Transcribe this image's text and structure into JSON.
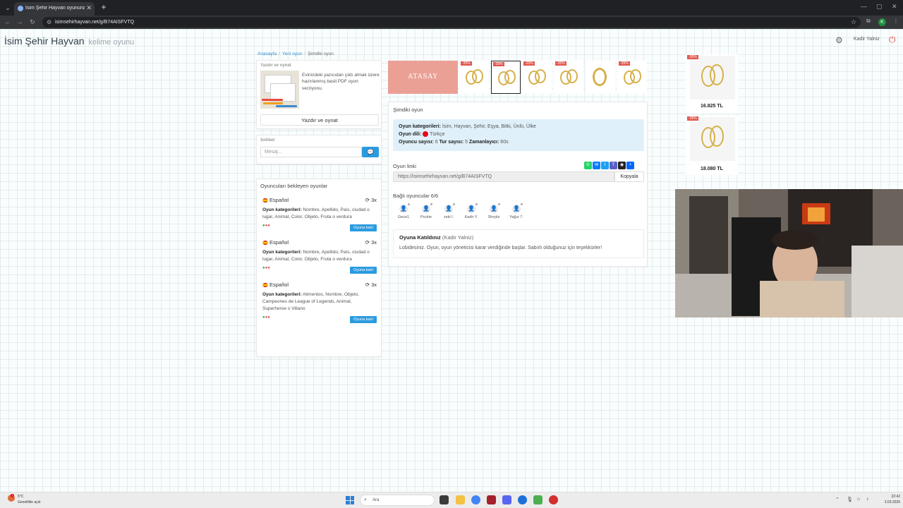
{
  "browser": {
    "tab_title": "İsim Şehir Hayvan oyununa katı",
    "url": "isimsehirhayvan.net/g/B74AISFVTQ",
    "profile_initial": "K"
  },
  "header": {
    "title": "İsim Şehir Hayvan",
    "subtitle": "kelime oyunu",
    "username": "Kadir Yalniz"
  },
  "breadcrumb": {
    "home": "Anasayfa",
    "new_game": "Yeni oyun",
    "current": "Şimdiki oyun"
  },
  "print_panel": {
    "heading": "Yazdır ve oynat",
    "description": "Evinizdeki yazıcıdan çıktı almak üzere hazırlanmış basit PDF oyun verziyonu.",
    "button": "Yazdır ve oynat"
  },
  "chat_panel": {
    "heading": "Sohbet",
    "placeholder": "Mesaj..."
  },
  "waiting_panel": {
    "title": "Oyuncuları bekleyen oyunlar",
    "categories_label": "Oyun kategorileri:",
    "games": [
      {
        "language": "Español",
        "rounds": "3x",
        "categories": "Nombre, Apellido, País, ciudad o lugar, Animal, Color, Objeto, Fruta o verdura",
        "join": "Oyuna katıl"
      },
      {
        "language": "Español",
        "rounds": "3x",
        "categories": "Nombre, Apellido, País, ciudad o lugar, Animal, Color, Objeto, Fruta o verdura",
        "join": "Oyuna katıl"
      },
      {
        "language": "Español",
        "rounds": "3x",
        "categories": "Alimentos, Nombre, Objeto, Campeones de League of Legends, Animal, Superheroe o Villano",
        "join": "Oyuna katıl"
      }
    ]
  },
  "ads": {
    "brand": "ATASAY",
    "discount": "-35%"
  },
  "game_panel": {
    "heading": "Şimdiki oyun",
    "categories_label": "Oyun kategorileri:",
    "categories": "İsim, Hayvan, Şehir, Eşya, Bitki, Ünlü, Ülke",
    "language_label": "Oyun dili:",
    "language": "Türkçe",
    "players_label": "Oyuncu sayısı:",
    "players_value": "6",
    "rounds_label": "Tur sayısı:",
    "rounds_value": "5",
    "timer_label": "Zamanlayıcı:",
    "timer_value": "60s",
    "link_label": "Oyun linki",
    "link": "https://isimsehirhayvan.net/g/B74AISFVTQ",
    "copy": "Kopyala",
    "connected_label": "Bağlı oyuncular 6/6",
    "players": [
      "Gece1",
      "Prulrie",
      "zeki l.",
      "Kadir Y.",
      "Shrytiz",
      "Yağız 7."
    ],
    "lobby_title": "Oyuna Katıldınız",
    "lobby_user": "(Kadir Yalniz)",
    "lobby_text": "Lobidesiniz. Oyun, oyun yöneticisi karar verdiğinde başlar. Sabırlı olduğunuz için teşekkürler!"
  },
  "products": [
    {
      "badge": "-35%",
      "price": "16.825 TL"
    },
    {
      "badge": "-35%",
      "price": "18.080 TL"
    }
  ],
  "taskbar": {
    "temperature": "5°C",
    "weather": "Genellikle açık",
    "search": "Ara",
    "time": "22:42",
    "date": "3.03.2026"
  },
  "colors": {
    "accent": "#2b9be0",
    "info_bg": "#dff0fa",
    "badge": "#e2574c",
    "ad_bg": "#eba095"
  }
}
